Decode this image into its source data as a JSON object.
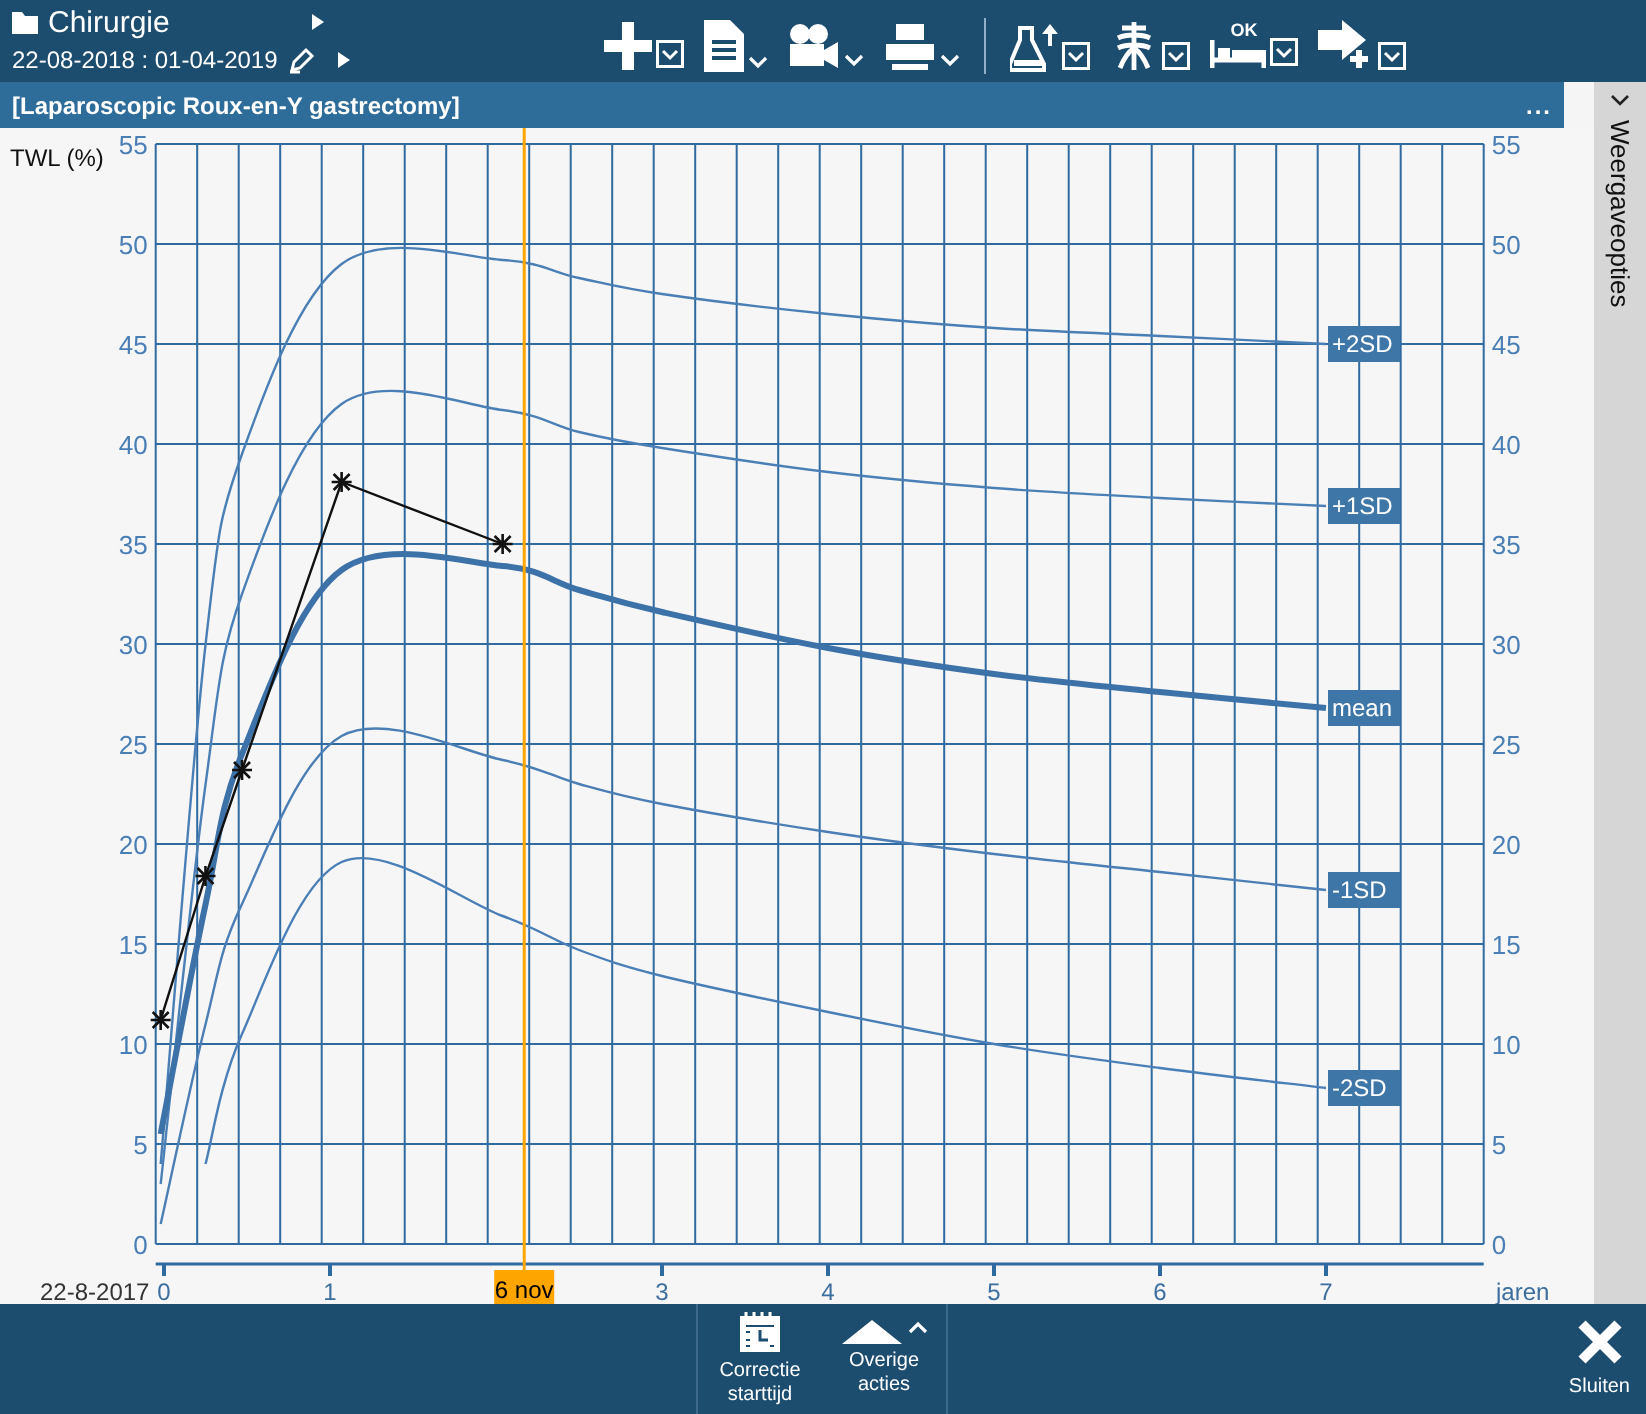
{
  "header": {
    "department": "Chirurgie",
    "period": "22-08-2018 : 01-04-2019"
  },
  "toolbar": [
    {
      "kind": "plus",
      "boxed_caret": true
    },
    {
      "kind": "document",
      "boxed_caret": false
    },
    {
      "kind": "camera",
      "boxed_caret": false
    },
    {
      "kind": "printer",
      "boxed_caret": false
    },
    {
      "kind": "flask",
      "boxed_caret": true
    },
    {
      "kind": "figure",
      "boxed_caret": true
    },
    {
      "kind": "bed",
      "boxed_caret": true,
      "badge": "OK"
    },
    {
      "kind": "arrow",
      "boxed_caret": true
    }
  ],
  "panel": {
    "title": "[Laparoscopic Roux-en-Y gastrectomy]",
    "menu": "..."
  },
  "side_panel": {
    "label": "Weergaveopties",
    "expanded": false
  },
  "chart": {
    "start_date": "22-8-2017",
    "right_ticks": [
      "55",
      "50",
      "45",
      "40",
      "35",
      "30",
      "25",
      "20",
      "15",
      "10",
      "5",
      "0"
    ],
    "bold_curves": [
      false,
      false,
      true,
      false,
      false,
      false
    ],
    "chart_data": {
      "type": "line",
      "ylabel": "TWL (%)",
      "xlabel": "jaren",
      "xlim": [
        -0.05,
        7.95
      ],
      "ylim": [
        0,
        55
      ],
      "grid": true,
      "xticks": [
        0,
        1,
        {
          "value": 2.17,
          "label": "6 nov"
        },
        3,
        4,
        5,
        6,
        7
      ],
      "yticks": [
        0,
        5,
        10,
        15,
        20,
        25,
        30,
        35,
        40,
        45,
        50,
        55
      ],
      "ref_lines": [
        {
          "axis": "x",
          "value": 2.17,
          "color": "#ffa500"
        }
      ],
      "x": [
        -0.02,
        0.25,
        0.47,
        1.07,
        2.04,
        2.5,
        3,
        4,
        5,
        6,
        7
      ],
      "series": [
        {
          "name": "+2SD",
          "color": "#4a7fb5",
          "values": [
            4,
            30,
            39.5,
            49,
            49.2,
            48.3,
            47.5,
            46.5,
            45.8,
            45.4,
            45
          ]
        },
        {
          "name": "+1SD",
          "color": "#4b80b6",
          "values": [
            3,
            23,
            32.5,
            42,
            41.7,
            40.6,
            39.8,
            38.6,
            37.8,
            37.3,
            36.9
          ]
        },
        {
          "name": "mean",
          "color": "#3d72a8",
          "values": [
            5.5,
            17,
            24.5,
            33.7,
            33.9,
            32.7,
            31.6,
            29.8,
            28.5,
            27.6,
            26.8
          ]
        },
        {
          "name": "-1SD",
          "color": "#4a7eb4",
          "values": [
            1,
            11,
            17,
            25.4,
            24.2,
            23,
            22,
            20.6,
            19.5,
            18.6,
            17.7
          ]
        },
        {
          "name": "-2SD",
          "color": "#497fb6",
          "values": [
            null,
            4,
            10.5,
            19.1,
            16.4,
            14.7,
            13.4,
            11.6,
            10,
            8.8,
            7.8
          ]
        },
        {
          "color": "#111111",
          "marker": "x",
          "values": [
            11.2,
            18.4,
            23.7,
            38.1,
            35.0,
            null,
            null,
            null,
            null,
            null,
            null
          ]
        }
      ]
    }
  },
  "footer": {
    "actions": [
      {
        "kind": "calendar",
        "label": "Correctie starttijd"
      },
      {
        "kind": "more",
        "label": "Overige acties"
      }
    ],
    "close": "Sluiten"
  }
}
